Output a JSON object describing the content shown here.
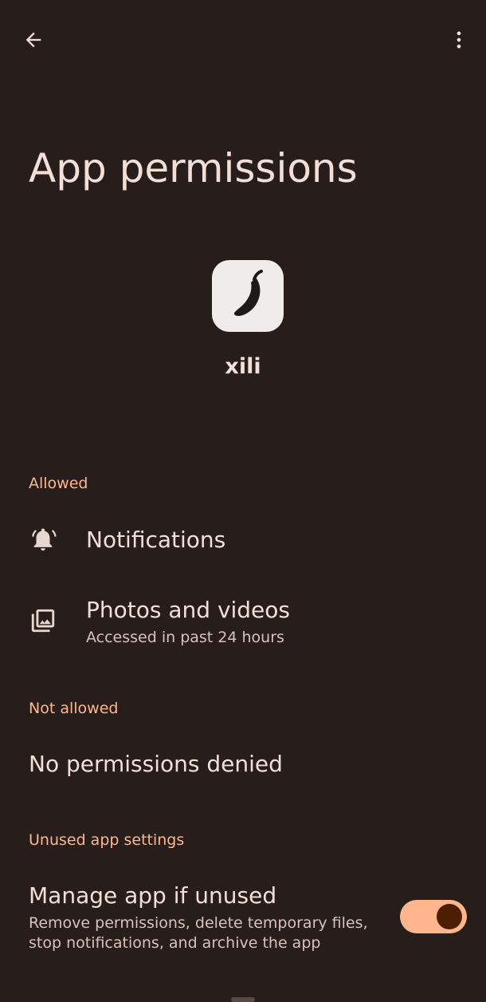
{
  "header": {
    "back_icon": "arrow-back-icon",
    "more_icon": "more-vert-icon"
  },
  "page": {
    "title": "App permissions"
  },
  "app": {
    "name": "xili",
    "icon": "chili-pepper-app-icon"
  },
  "sections": {
    "allowed": {
      "header": "Allowed",
      "items": [
        {
          "title": "Notifications",
          "subtitle": "",
          "icon": "notification-bell-icon"
        },
        {
          "title": "Photos and videos",
          "subtitle": "Accessed in past 24 hours",
          "icon": "photo-library-icon"
        }
      ]
    },
    "not_allowed": {
      "header": "Not allowed",
      "empty_text": "No permissions denied"
    },
    "unused": {
      "header": "Unused app settings",
      "manage_title": "Manage app if unused",
      "manage_desc_line1": "Remove permissions, delete temporary files,",
      "manage_desc_line2": "stop notifications, and archive the app",
      "toggle_on": true
    }
  },
  "colors": {
    "background": "#271e1b",
    "accent": "#ffb68c",
    "text_primary": "#f2dfd8",
    "text_secondary": "#d8c2b9",
    "toggle_knob": "#4a1f02"
  }
}
